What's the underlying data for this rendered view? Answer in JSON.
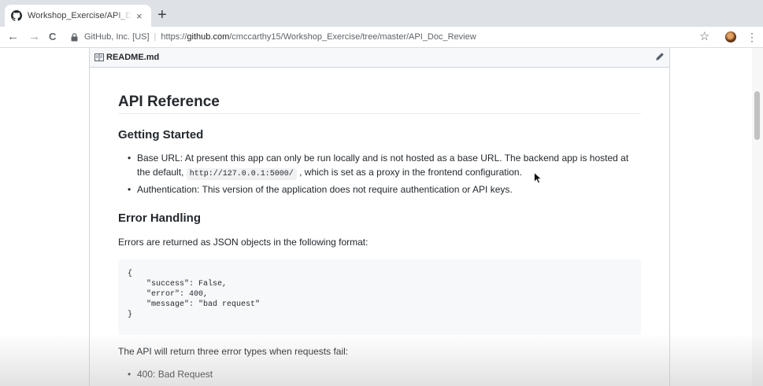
{
  "browser": {
    "tab": {
      "title": "Workshop_Exercise/API_Doc_R",
      "close": "×",
      "icon": "github-icon"
    },
    "new_tab": "+",
    "nav": {
      "back": "←",
      "forward": "→",
      "reload": "C"
    },
    "address": {
      "site": "GitHub, Inc. [US]",
      "separator": "|",
      "scheme": "https://",
      "host": "github.com",
      "path": "/cmccarthy15/Workshop_Exercise/tree/master/API_Doc_Review"
    },
    "star": "☆",
    "menu": "⋮"
  },
  "readme": {
    "filename": "README.md",
    "h1": "API Reference",
    "sections": {
      "getting_started": {
        "heading": "Getting Started",
        "base_url_line1": "Base URL: At present this app can only be run locally and is not hosted as a base URL. The backend app is hosted at",
        "base_url_line2_pre": "the default,",
        "base_url_code": "http://127.0.0.1:5000/",
        "base_url_line2_post": ", which is set as a proxy in the frontend configuration.",
        "auth": "Authentication: This version of the application does not require authentication or API keys."
      },
      "error_handling": {
        "heading": "Error Handling",
        "intro": "Errors are returned as JSON objects in the following format:",
        "code": "{\n    \"success\": False,\n    \"error\": 400,\n    \"message\": \"bad request\"\n}",
        "after": "The API will return three error types when requests fail:",
        "errors": [
          "400: Bad Request"
        ]
      }
    }
  },
  "colors": {
    "accent": "#0366d6",
    "text": "#24292e",
    "code_bg": "#f6f8fa"
  }
}
